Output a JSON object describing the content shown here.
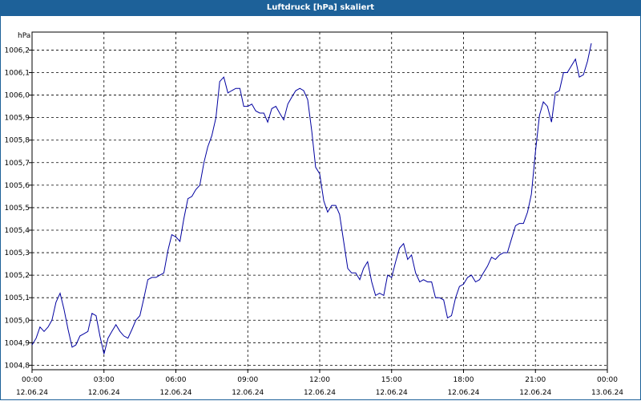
{
  "title": "Luftdruck [hPa] skaliert",
  "chart_data": {
    "type": "line",
    "title": "Luftdruck [hPa] skaliert",
    "ylabel": "hPa",
    "xlabel": "",
    "ylim": [
      1004.78,
      1006.28
    ],
    "xlim_hours": [
      0,
      24
    ],
    "grid": true,
    "y_ticks": [
      "1004,8",
      "1004,9",
      "1005,0",
      "1005,1",
      "1005,2",
      "1005,3",
      "1005,4",
      "1005,5",
      "1005,6",
      "1005,7",
      "1005,8",
      "1005,9",
      "1006,0",
      "1006,1",
      "1006,2"
    ],
    "x_ticks": [
      {
        "time": "00:00",
        "date": "12.06.24"
      },
      {
        "time": "03:00",
        "date": "12.06.24"
      },
      {
        "time": "06:00",
        "date": "12.06.24"
      },
      {
        "time": "09:00",
        "date": "12.06.24"
      },
      {
        "time": "12:00",
        "date": "12.06.24"
      },
      {
        "time": "15:00",
        "date": "12.06.24"
      },
      {
        "time": "18:00",
        "date": "12.06.24"
      },
      {
        "time": "21:00",
        "date": "12.06.24"
      },
      {
        "time": "00:00",
        "date": "13.06.24"
      }
    ],
    "series": [
      {
        "color": "#0000a0",
        "x_hours": [
          0.0,
          0.17,
          0.33,
          0.5,
          0.67,
          0.83,
          1.0,
          1.17,
          1.33,
          1.5,
          1.67,
          1.83,
          2.0,
          2.17,
          2.33,
          2.5,
          2.67,
          2.83,
          3.0,
          3.17,
          3.33,
          3.5,
          3.67,
          3.83,
          4.0,
          4.17,
          4.33,
          4.5,
          4.67,
          4.83,
          5.0,
          5.17,
          5.33,
          5.5,
          5.67,
          5.83,
          6.0,
          6.17,
          6.33,
          6.5,
          6.67,
          6.83,
          7.0,
          7.17,
          7.33,
          7.5,
          7.67,
          7.83,
          8.0,
          8.17,
          8.33,
          8.5,
          8.67,
          8.83,
          9.0,
          9.17,
          9.33,
          9.5,
          9.67,
          9.83,
          10.0,
          10.17,
          10.33,
          10.5,
          10.67,
          10.83,
          11.0,
          11.17,
          11.33,
          11.5,
          11.67,
          11.83,
          12.0,
          12.17,
          12.33,
          12.5,
          12.67,
          12.83,
          13.0,
          13.17,
          13.33,
          13.5,
          13.67,
          13.83,
          14.0,
          14.17,
          14.33,
          14.5,
          14.67,
          14.83,
          15.0,
          15.17,
          15.33,
          15.5,
          15.67,
          15.83,
          16.0,
          16.17,
          16.33,
          16.5,
          16.67,
          16.83,
          17.0,
          17.17,
          17.33,
          17.5,
          17.67,
          17.83,
          18.0,
          18.17,
          18.33,
          18.5,
          18.67,
          18.83,
          19.0,
          19.17,
          19.33,
          19.5,
          19.67,
          19.83,
          20.0,
          20.17,
          20.33,
          20.5,
          20.67,
          20.83,
          21.0,
          21.17,
          21.33,
          21.5,
          21.67,
          21.83,
          22.0,
          22.17,
          22.33,
          22.5,
          22.67,
          22.83,
          23.0,
          23.17,
          23.33,
          23.5,
          23.67,
          23.83,
          24.0
        ],
        "values": [
          1004.89,
          1004.92,
          1004.97,
          1004.95,
          1004.97,
          1005.0,
          1005.08,
          1005.12,
          1005.05,
          1004.96,
          1004.88,
          1004.89,
          1004.93,
          1004.94,
          1004.95,
          1005.03,
          1005.02,
          1004.93,
          1004.85,
          1004.92,
          1004.95,
          1004.98,
          1004.95,
          1004.93,
          1004.92,
          1004.96,
          1005.0,
          1005.02,
          1005.1,
          1005.18,
          1005.19,
          1005.19,
          1005.2,
          1005.21,
          1005.31,
          1005.38,
          1005.37,
          1005.35,
          1005.45,
          1005.54,
          1005.55,
          1005.58,
          1005.6,
          1005.7,
          1005.77,
          1005.82,
          1005.9,
          1006.06,
          1006.08,
          1006.01,
          1006.02,
          1006.03,
          1006.03,
          1005.95,
          1005.95,
          1005.96,
          1005.93,
          1005.92,
          1005.92,
          1005.88,
          1005.94,
          1005.95,
          1005.92,
          1005.89,
          1005.96,
          1005.99,
          1006.02,
          1006.03,
          1006.02,
          1005.98,
          1005.84,
          1005.68,
          1005.65,
          1005.53,
          1005.48,
          1005.51,
          1005.51,
          1005.47,
          1005.35,
          1005.23,
          1005.21,
          1005.21,
          1005.18,
          1005.23,
          1005.26,
          1005.17,
          1005.11,
          1005.12,
          1005.11,
          1005.2,
          1005.19,
          1005.26,
          1005.32,
          1005.34,
          1005.27,
          1005.29,
          1005.21,
          1005.17,
          1005.18,
          1005.17,
          1005.17,
          1005.1,
          1005.1,
          1005.09,
          1005.01,
          1005.02,
          1005.1,
          1005.15,
          1005.16,
          1005.19,
          1005.2,
          1005.17,
          1005.18,
          1005.21,
          1005.24,
          1005.28,
          1005.27,
          1005.29,
          1005.3,
          1005.3,
          1005.36,
          1005.42,
          1005.43,
          1005.43,
          1005.48,
          1005.56,
          1005.75,
          1005.91,
          1005.97,
          1005.95,
          1005.88,
          1006.01,
          1006.02,
          1006.1,
          1006.1,
          1006.13,
          1006.16,
          1006.08,
          1006.09,
          1006.15,
          1006.23
        ]
      }
    ]
  }
}
